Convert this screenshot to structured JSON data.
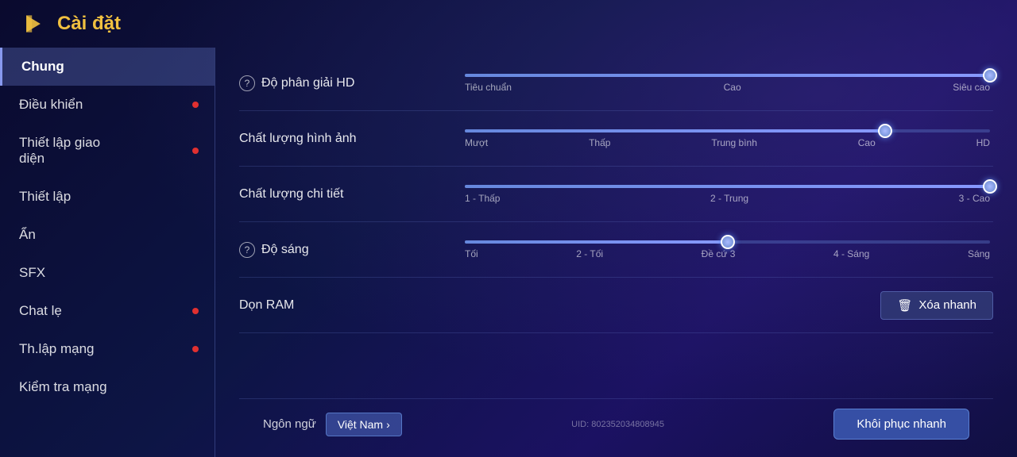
{
  "header": {
    "title": "Cài đặt",
    "logo_symbol": "D"
  },
  "sidebar": {
    "items": [
      {
        "id": "chung",
        "label": "Chung",
        "active": true,
        "dot": false
      },
      {
        "id": "dieu-khien",
        "label": "Điều khiển",
        "active": false,
        "dot": true
      },
      {
        "id": "thiet-lap-giao-dien",
        "label": "Thiết lập giao diện",
        "active": false,
        "dot": true
      },
      {
        "id": "thiet-lap",
        "label": "Thiết lập",
        "active": false,
        "dot": false
      },
      {
        "id": "an",
        "label": "Ẩn",
        "active": false,
        "dot": false
      },
      {
        "id": "sfx",
        "label": "SFX",
        "active": false,
        "dot": false
      },
      {
        "id": "chat-le",
        "label": "Chat lẹ",
        "active": false,
        "dot": true
      },
      {
        "id": "th-lap-mang",
        "label": "Th.lập mạng",
        "active": false,
        "dot": true
      },
      {
        "id": "kiem-tra-mang",
        "label": "Kiểm tra mạng",
        "active": false,
        "dot": false
      }
    ]
  },
  "settings": {
    "rows": [
      {
        "id": "do-phan-giai",
        "label": "Độ phân giải HD",
        "has_help": true,
        "slider": {
          "fill_pct": 100,
          "thumb_pct": 100,
          "labels": [
            "Tiêu chuẩn",
            "Cao",
            "Siêu cao"
          ]
        },
        "type": "slider"
      },
      {
        "id": "chat-luong-hinh-anh",
        "label": "Chất lượng hình ảnh",
        "has_help": false,
        "slider": {
          "fill_pct": 80,
          "thumb_pct": 80,
          "labels": [
            "Mượt",
            "Thấp",
            "Trung bình",
            "Cao",
            "HD"
          ]
        },
        "type": "slider"
      },
      {
        "id": "chat-luong-chi-tiet",
        "label": "Chất lượng chi tiết",
        "has_help": false,
        "slider": {
          "fill_pct": 100,
          "thumb_pct": 100,
          "labels": [
            "1 - Thấp",
            "2 - Trung",
            "3 - Cao"
          ]
        },
        "type": "slider"
      },
      {
        "id": "do-sang",
        "label": "Độ sáng",
        "has_help": true,
        "slider": {
          "fill_pct": 50,
          "thumb_pct": 50,
          "labels": [
            "Tối",
            "2 - Tối",
            "Đề cứ 3",
            "4 - Sáng",
            "Sáng"
          ]
        },
        "type": "slider"
      },
      {
        "id": "don-ram",
        "label": "Dọn RAM",
        "has_help": false,
        "type": "button",
        "button_label": "Xóa nhanh"
      }
    ]
  },
  "bottom": {
    "language_label": "Ngôn ngữ",
    "language_value": "Việt Nam",
    "language_arrow": "›",
    "restore_label": "Khôi phục nhanh",
    "uid_label": "UID: 802352034808945"
  },
  "icons": {
    "trash": "🗑",
    "help": "?",
    "chevron_right": "›"
  }
}
